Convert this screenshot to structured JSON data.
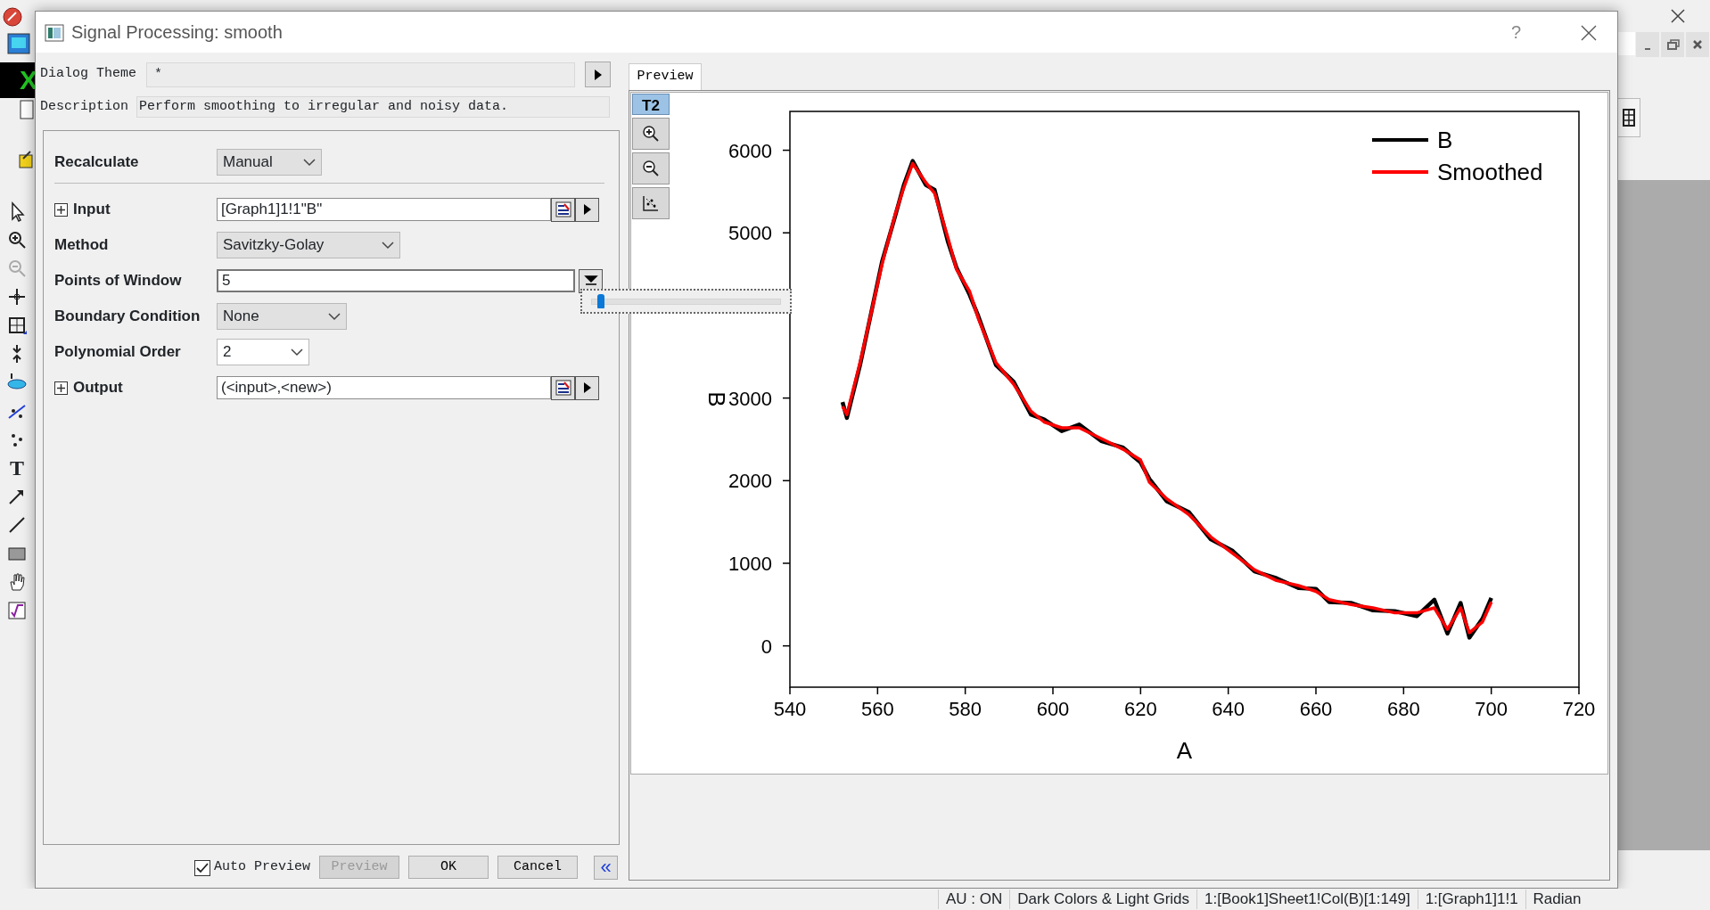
{
  "app": {
    "workbook_letter": "X",
    "text_tool": "T"
  },
  "dialog": {
    "title": "Signal Processing: smooth",
    "help": "?",
    "dialog_theme": {
      "label": "Dialog Theme",
      "value": "*"
    },
    "description": {
      "label": "Description",
      "value": "Perform smoothing to irregular and noisy data."
    },
    "params": [
      {
        "kind": "select",
        "label": "Recalculate",
        "value": "Manual"
      },
      {
        "kind": "range",
        "label": "Input",
        "expanded": false,
        "value": "[Graph1]1!1\"B\""
      },
      {
        "kind": "select",
        "label": "Method",
        "value": "Savitzky-Golay"
      },
      {
        "kind": "slider",
        "label": "Points of Window",
        "value": "5",
        "popup_open": true,
        "level": 0.03
      },
      {
        "kind": "select",
        "label": "Boundary Condition",
        "value": "None"
      },
      {
        "kind": "combo",
        "label": "Polynomial Order",
        "value": "2"
      },
      {
        "kind": "range",
        "label": "Output",
        "expanded": false,
        "value": "(<input>,<new>)"
      }
    ],
    "footer": {
      "auto_preview": {
        "label": "Auto Preview",
        "checked": true
      },
      "buttons": [
        {
          "label": "Preview",
          "disabled": true
        },
        {
          "label": "OK",
          "disabled": false
        },
        {
          "label": "Cancel",
          "disabled": false
        }
      ],
      "collapse": "«"
    },
    "preview_tabs": [
      {
        "label": "Preview",
        "selected": true
      }
    ],
    "graph": {
      "layer_button": "T2",
      "chart_data": {
        "type": "line",
        "xlabel": "A",
        "ylabel": "B",
        "x": [
          552,
          553,
          556,
          561,
          564,
          566,
          568,
          571,
          573,
          576,
          578,
          581,
          583,
          587,
          591,
          595,
          598,
          602,
          606,
          611,
          616,
          620,
          622,
          626,
          631,
          636,
          641,
          646,
          651,
          656,
          660,
          663,
          668,
          673,
          678,
          683,
          687,
          690,
          693,
          695,
          698,
          700
        ],
        "series": [
          {
            "name": "B",
            "color": "#000000",
            "values": [
              2950,
              2760,
              3400,
              4650,
              5200,
              5580,
              5870,
              5580,
              5520,
              4900,
              4580,
              4250,
              3990,
              3400,
              3200,
              2800,
              2740,
              2600,
              2680,
              2480,
              2400,
              2220,
              2020,
              1750,
              1620,
              1290,
              1150,
              900,
              820,
              700,
              690,
              530,
              520,
              430,
              420,
              360,
              560,
              150,
              520,
              100,
              330,
              580
            ]
          },
          {
            "name": "Smoothed",
            "color": "#ff0000",
            "values": [
              2900,
              2800,
              3430,
              4620,
              5220,
              5550,
              5840,
              5610,
              5480,
              4950,
              4560,
              4290,
              3960,
              3430,
              3170,
              2840,
              2710,
              2640,
              2640,
              2510,
              2380,
              2250,
              1980,
              1780,
              1590,
              1320,
              1120,
              920,
              790,
              730,
              660,
              560,
              500,
              460,
              400,
              400,
              460,
              200,
              460,
              160,
              290,
              530
            ]
          }
        ],
        "xlim": [
          540,
          720
        ],
        "ylim": [
          -500,
          6470
        ],
        "xticks": [
          540,
          560,
          580,
          600,
          620,
          640,
          660,
          680,
          700,
          720
        ],
        "yticks": [
          0,
          1000,
          2000,
          3000,
          5000,
          6000
        ],
        "legend": true
      }
    }
  },
  "status_bar": [
    "AU : ON",
    "Dark Colors & Light Grids",
    "1:[Book1]Sheet1!Col(B)[1:149]",
    "1:[Graph1]1!1",
    "Radian"
  ]
}
